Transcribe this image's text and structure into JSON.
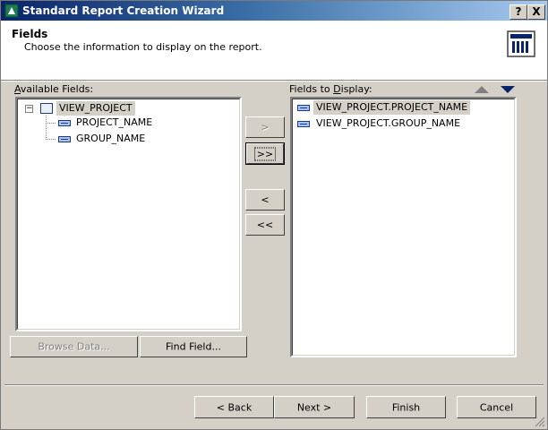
{
  "window": {
    "title": "Standard Report Creation Wizard",
    "help_button": "?",
    "close_button": "X"
  },
  "header": {
    "title": "Fields",
    "subtitle": "Choose the information to display on the report."
  },
  "available": {
    "label": "Available Fields:",
    "tree": {
      "root": "VIEW_PROJECT",
      "children": [
        "PROJECT_NAME",
        "GROUP_NAME"
      ]
    }
  },
  "display": {
    "label": "Fields to Display:",
    "items": [
      "VIEW_PROJECT.PROJECT_NAME",
      "VIEW_PROJECT.GROUP_NAME"
    ]
  },
  "move_buttons": {
    "add_one": ">",
    "add_all": ">>",
    "remove_one": "<",
    "remove_all": "<<"
  },
  "left_buttons": {
    "browse": "Browse Data...",
    "find": "Find Field..."
  },
  "nav": {
    "back": "< Back",
    "next": "Next >",
    "finish": "Finish",
    "cancel": "Cancel"
  },
  "colors": {
    "titlebar_start": "#0a246a",
    "face": "#d4d0c8",
    "order_arrow_active": "#0a246a",
    "order_arrow_inactive": "#808080"
  }
}
